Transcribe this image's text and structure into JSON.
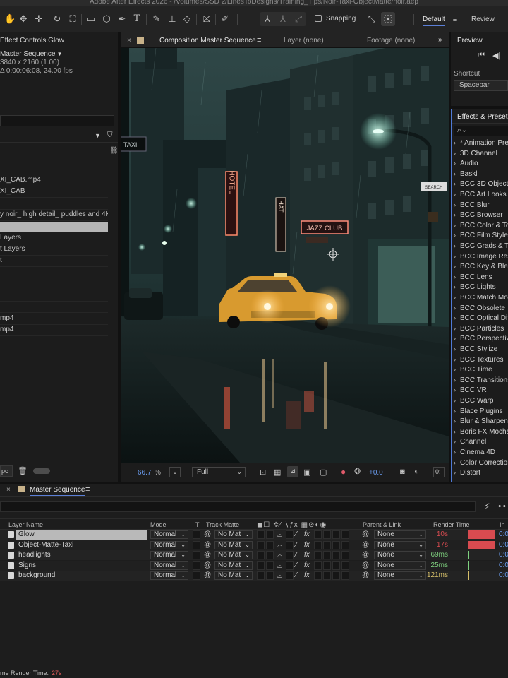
{
  "app": {
    "title": "Adobe After Effects 2026 - /Volumes/SSD 2/LinesToDesigns/Training_Tips/Noir-Taxi-ObjectMatte/noir.aep"
  },
  "toolbar": {
    "snapping_label": "Snapping",
    "workspace_default": "Default",
    "workspace_review": "Review"
  },
  "project": {
    "tab": "Effect Controls Glow",
    "comp_name": "Master Sequence",
    "resolution": "3840 x 2160 (1.00)",
    "duration": "Δ 0:00:06:08, 24.00 fps",
    "items": [
      "XI_CAB.mp4",
      "XI_CAB",
      "",
      "y noir_ high detail_ puddles and 4K",
      "",
      "Layers",
      "t Layers",
      "t",
      "",
      "",
      "",
      "",
      "mp4",
      "mp4",
      "",
      ""
    ],
    "bpc": "pc"
  },
  "composition": {
    "tab": "Composition Master Sequence",
    "layer_tab": "Layer (none)",
    "footage_tab": "Footage (none)",
    "zoom": "66.7",
    "zoom_unit": "%",
    "resolution": "Full",
    "exposure": "+0.0",
    "sign_taxi": "TAXI",
    "sign_hotel_v": "HOTEL",
    "sign_hotel_short": "HAT",
    "sign_jazz": "JAZZ CLUB",
    "sign_street": "SEARCH"
  },
  "preview": {
    "tab": "Preview",
    "shortcut_label": "Shortcut",
    "shortcut_value": "Spacebar"
  },
  "effects_presets": {
    "tab": "Effects & Presets",
    "search_placeholder": "",
    "items": [
      "* Animation Presets",
      "3D Channel",
      "Audio",
      "Baskl",
      "BCC 3D Objects",
      "BCC Art Looks",
      "BCC Blur",
      "BCC Browser",
      "BCC Color & Tone",
      "BCC Film Style",
      "BCC Grads & Tints",
      "BCC Image Restoration",
      "BCC Key & Blend",
      "BCC Lens",
      "BCC Lights",
      "BCC Match Move",
      "BCC Obsolete",
      "BCC Optical Diffusion",
      "BCC Particles",
      "BCC Perspective",
      "BCC Stylize",
      "BCC Textures",
      "BCC Time",
      "BCC Transitions",
      "BCC VR",
      "BCC Warp",
      "Blace Plugins",
      "Blur & Sharpen",
      "Boris FX Mocha",
      "Channel",
      "Cinema 4D",
      "Color Correction",
      "Distort"
    ]
  },
  "timeline": {
    "tab": "Master Sequence",
    "headers": {
      "layer_name": "Layer Name",
      "mode": "Mode",
      "t": "T",
      "track_matte": "Track Matte",
      "parent": "Parent & Link",
      "render_time": "Render Time",
      "in": "In"
    },
    "layers": [
      {
        "name": "Glow",
        "mode": "Normal",
        "matte": "No Mat",
        "parent": "None",
        "render": "10s",
        "render_color": "#d84b50",
        "bar": 1.0,
        "in": "0:0",
        "selected": true
      },
      {
        "name": "Object-Matte-Taxi",
        "mode": "Normal",
        "matte": "No Mat",
        "parent": "None",
        "render": "17s",
        "render_color": "#d84b50",
        "bar": 1.0,
        "in": "0:0",
        "selected": false
      },
      {
        "name": "headlights",
        "mode": "Normal",
        "matte": "No Mat",
        "parent": "None",
        "render": "69ms",
        "render_color": "#7fd27f",
        "bar": 0.05,
        "in": "0:0",
        "selected": false
      },
      {
        "name": "Signs",
        "mode": "Normal",
        "matte": "No Mat",
        "parent": "None",
        "render": "25ms",
        "render_color": "#7fd27f",
        "bar": 0.04,
        "in": "0:0",
        "selected": false
      },
      {
        "name": "background",
        "mode": "Normal",
        "matte": "No Mat",
        "parent": "None",
        "render": "121ms",
        "render_color": "#d7c06a",
        "bar": 0.06,
        "in": "0:0",
        "selected": false
      }
    ],
    "frame_render_label": "me Render Time:",
    "frame_render_value": "27s"
  }
}
